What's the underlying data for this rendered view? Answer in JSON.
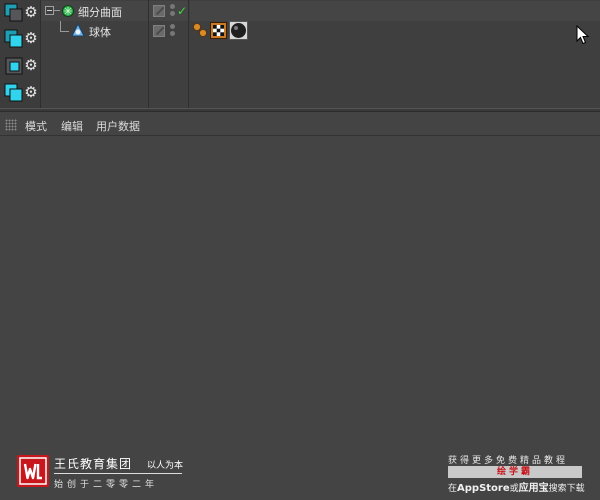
{
  "object_manager": {
    "rows": [
      {
        "name": "细分曲面",
        "icon": "subdivision-surface-icon",
        "expanded": true
      },
      {
        "name": "球体",
        "icon": "sphere-icon"
      }
    ],
    "tags": [
      "phong-tag-icon",
      "texture-tag-icon",
      "material-tag-icon"
    ]
  },
  "attribute_manager": {
    "menu": [
      "模式",
      "编辑",
      "用户数据"
    ]
  },
  "watermark_left": {
    "title": "王氏教育集团",
    "slogan": "以人为本",
    "since": "始创于二零零二年"
  },
  "watermark_right": {
    "line1": "获得更多免费精品教程",
    "line2": "绘学霸",
    "line3_prefix": "在",
    "line3_app": "AppStore",
    "line3_mid": "或",
    "line3_store": "应用宝",
    "line3_suffix": "搜索下载"
  },
  "colors": {
    "background": "#444444",
    "panel": "#3f3f3f",
    "accent_cyan": "#2fd0e6",
    "check_green": "#3cdc3c",
    "brand_red": "#c8161d"
  }
}
